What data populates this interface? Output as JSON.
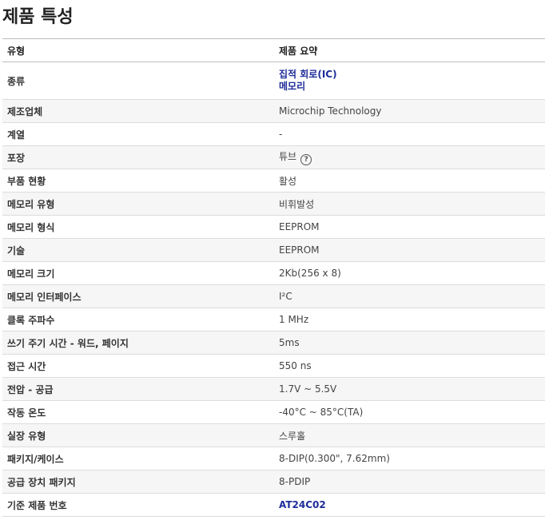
{
  "page_title": "제품 특성",
  "header": {
    "col_type": "유형",
    "col_summary": "제품 요약"
  },
  "rows": [
    {
      "attr": "종류",
      "links": [
        "집적 회로(IC)",
        "메모리"
      ]
    },
    {
      "attr": "제조업체",
      "value": "Microchip Technology"
    },
    {
      "attr": "계열",
      "value": "-"
    },
    {
      "attr": "포장",
      "value": "튜브",
      "icon": "help-circle-icon",
      "icon_glyph": "?"
    },
    {
      "attr": "부품 현황",
      "value": "활성"
    },
    {
      "attr": "메모리 유형",
      "value": "비휘발성"
    },
    {
      "attr": "메모리 형식",
      "value": "EEPROM"
    },
    {
      "attr": "기술",
      "value": "EEPROM"
    },
    {
      "attr": "메모리 크기",
      "value": "2Kb(256 x 8)"
    },
    {
      "attr": "메모리 인터페이스",
      "value": "I²C"
    },
    {
      "attr": "클록 주파수",
      "value": "1 MHz"
    },
    {
      "attr": "쓰기 주기 시간 - 워드, 페이지",
      "value": "5ms"
    },
    {
      "attr": "접근 시간",
      "value": "550 ns"
    },
    {
      "attr": "전압 - 공급",
      "value": "1.7V ~ 5.5V"
    },
    {
      "attr": "작동 온도",
      "value": "-40°C ~ 85°C(TA)"
    },
    {
      "attr": "실장 유형",
      "value": "스루홀"
    },
    {
      "attr": "패키지/케이스",
      "value": "8-DIP(0.300\", 7.62mm)"
    },
    {
      "attr": "공급 장치 패키지",
      "value": "8-PDIP"
    },
    {
      "attr": "기준 제품 번호",
      "link_value": "AT24C02"
    }
  ],
  "colors": {
    "link": "#1f2d9a",
    "row_shade": "#f6f6f6",
    "border": "#dcdcdc"
  }
}
